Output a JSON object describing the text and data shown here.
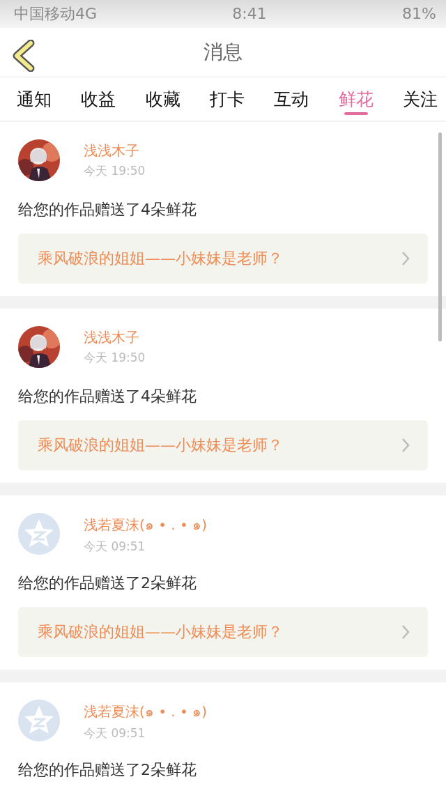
{
  "status_bar": {
    "carrier": "中国移动4G",
    "time": "8:41",
    "battery": "81%"
  },
  "header": {
    "title": "消息"
  },
  "tabs": [
    {
      "label": "通知",
      "selected": false
    },
    {
      "label": "收益",
      "selected": false
    },
    {
      "label": "收藏",
      "selected": false
    },
    {
      "label": "打卡",
      "selected": false
    },
    {
      "label": "互动",
      "selected": false
    },
    {
      "label": "鲜花",
      "selected": true
    },
    {
      "label": "关注",
      "selected": false
    }
  ],
  "messages": [
    {
      "name": "浅浅木子",
      "time": "今天 19:50",
      "text": "给您的作品赠送了4朵鲜花",
      "link": "乘风破浪的姐姐——小妹妹是老师？"
    },
    {
      "name": "浅浅木子",
      "time": "今天 19:50",
      "text": "给您的作品赠送了4朵鲜花",
      "link": "乘风破浪的姐姐——小妹妹是老师？"
    },
    {
      "avatar": {
        "kind": "default"
      },
      "name": "浅若夏沫(๑ • . • ๑)",
      "time": "今天 09:51",
      "text": "给您的作品赠送了2朵鲜花",
      "link": "乘风破浪的姐姐——小妹妹是老师？"
    },
    {
      "avatar": {
        "kind": "default"
      },
      "name": "浅若夏沫(๑ • . • ๑)",
      "time": "今天 09:51",
      "text": "给您的作品赠送了2朵鲜花"
    }
  ]
}
